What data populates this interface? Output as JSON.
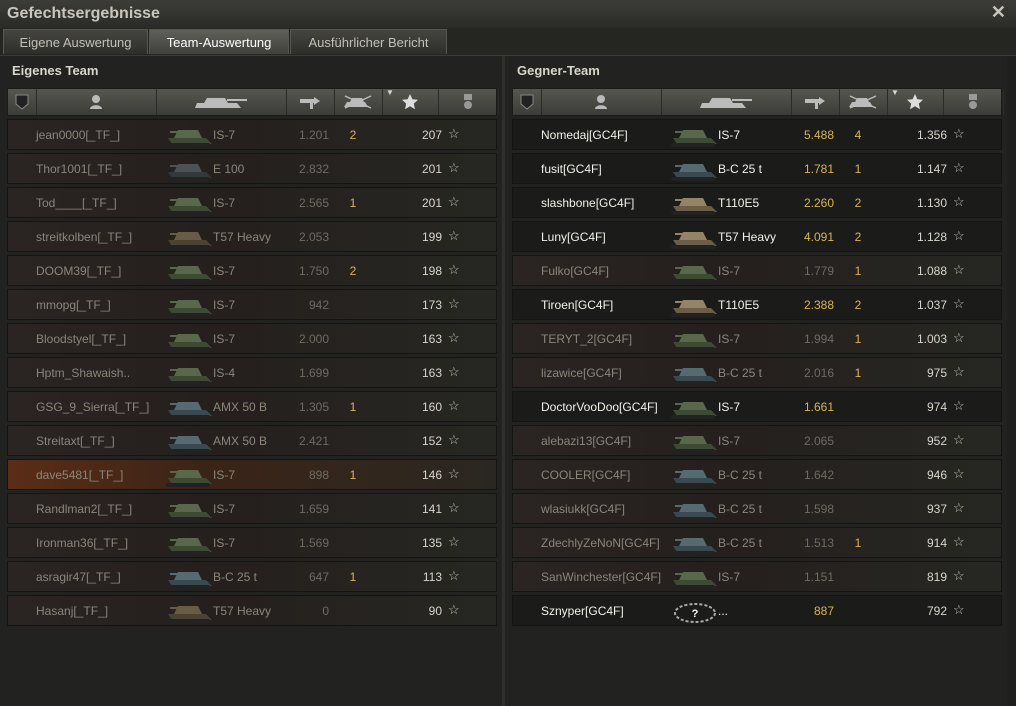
{
  "window": {
    "title": "Gefechtsergebnisse",
    "close_icon": "close-icon"
  },
  "tabs": [
    {
      "label": "Eigene Auswertung",
      "active": false
    },
    {
      "label": "Team-Auswertung",
      "active": true
    },
    {
      "label": "Ausführlicher Bericht",
      "active": false
    }
  ],
  "own_team": {
    "title": "Eigenes Team",
    "columns": [
      "vehicle-type-icon",
      "player-icon",
      "tank-icon",
      "damage-icon",
      "kills-icon",
      "xp-star-icon",
      "medal-icon"
    ],
    "rows": [
      {
        "name": "jean0000[_TF_]",
        "tank": "IS-7",
        "damage": "1.201",
        "kills": "2",
        "xp": "207",
        "highlight": false,
        "bright": false,
        "camo": "green"
      },
      {
        "name": "Thor1001[_TF_]",
        "tank": "E 100",
        "damage": "2.832",
        "kills": "",
        "xp": "201",
        "highlight": false,
        "bright": false,
        "camo": "dark"
      },
      {
        "name": "Tod____[_TF_]",
        "tank": "IS-7",
        "damage": "2.565",
        "kills": "1",
        "xp": "201",
        "highlight": false,
        "bright": false,
        "camo": "green"
      },
      {
        "name": "streitkolben[_TF_]",
        "tank": "T57 Heavy",
        "damage": "2.053",
        "kills": "",
        "xp": "199",
        "highlight": false,
        "bright": false,
        "camo": "brown"
      },
      {
        "name": "DOOM39[_TF_]",
        "tank": "IS-7",
        "damage": "1.750",
        "kills": "2",
        "xp": "198",
        "highlight": false,
        "bright": false,
        "camo": "green"
      },
      {
        "name": "mmopg[_TF_]",
        "tank": "IS-7",
        "damage": "942",
        "kills": "",
        "xp": "173",
        "highlight": false,
        "bright": false,
        "camo": "green"
      },
      {
        "name": "Bloodstyel[_TF_]",
        "tank": "IS-7",
        "damage": "2.000",
        "kills": "",
        "xp": "163",
        "highlight": false,
        "bright": false,
        "camo": "green"
      },
      {
        "name": "Hptm_Shawaish..",
        "tank": "IS-4",
        "damage": "1.699",
        "kills": "",
        "xp": "163",
        "highlight": false,
        "bright": false,
        "camo": "green"
      },
      {
        "name": "GSG_9_Sierra[_TF_]",
        "tank": "AMX 50 B",
        "damage": "1.305",
        "kills": "1",
        "xp": "160",
        "highlight": false,
        "bright": false,
        "camo": "blue"
      },
      {
        "name": "Streitaxt[_TF_]",
        "tank": "AMX 50 B",
        "damage": "2.421",
        "kills": "",
        "xp": "152",
        "highlight": false,
        "bright": false,
        "camo": "blue"
      },
      {
        "name": "dave5481[_TF_]",
        "tank": "IS-7",
        "damage": "898",
        "kills": "1",
        "xp": "146",
        "highlight": true,
        "bright": false,
        "camo": "green"
      },
      {
        "name": "Randlman2[_TF_]",
        "tank": "IS-7",
        "damage": "1.659",
        "kills": "",
        "xp": "141",
        "highlight": false,
        "bright": false,
        "camo": "green"
      },
      {
        "name": "Ironman36[_TF_]",
        "tank": "IS-7",
        "damage": "1.569",
        "kills": "",
        "xp": "135",
        "highlight": false,
        "bright": false,
        "camo": "green"
      },
      {
        "name": "asragir47[_TF_]",
        "tank": "B-C 25 t",
        "damage": "647",
        "kills": "1",
        "xp": "113",
        "highlight": false,
        "bright": false,
        "camo": "blue"
      },
      {
        "name": "Hasanj[_TF_]",
        "tank": "T57 Heavy",
        "damage": "0",
        "kills": "",
        "xp": "90",
        "highlight": false,
        "bright": false,
        "camo": "brown"
      }
    ]
  },
  "enemy_team": {
    "title": "Gegner-Team",
    "columns": [
      "vehicle-type-icon",
      "player-icon",
      "tank-icon",
      "damage-icon",
      "kills-icon",
      "xp-star-icon",
      "medal-icon"
    ],
    "rows": [
      {
        "name": "Nomedaj[GC4F]",
        "tank": "IS-7",
        "damage": "5.488",
        "kills": "4",
        "xp": "1.356",
        "highlight": false,
        "bright": true,
        "camo": "green"
      },
      {
        "name": "fusit[GC4F]",
        "tank": "B-C 25 t",
        "damage": "1.781",
        "kills": "1",
        "xp": "1.147",
        "highlight": false,
        "bright": true,
        "camo": "blue"
      },
      {
        "name": "slashbone[GC4F]",
        "tank": "T110E5",
        "damage": "2.260",
        "kills": "2",
        "xp": "1.130",
        "highlight": false,
        "bright": true,
        "camo": "tan"
      },
      {
        "name": "Luny[GC4F]",
        "tank": "T57 Heavy",
        "damage": "4.091",
        "kills": "2",
        "xp": "1.128",
        "highlight": false,
        "bright": true,
        "camo": "tan"
      },
      {
        "name": "Fulko[GC4F]",
        "tank": "IS-7",
        "damage": "1.779",
        "kills": "1",
        "xp": "1.088",
        "highlight": false,
        "bright": false,
        "camo": "green"
      },
      {
        "name": "Tiroen[GC4F]",
        "tank": "T110E5",
        "damage": "2.388",
        "kills": "2",
        "xp": "1.037",
        "highlight": false,
        "bright": true,
        "camo": "tan"
      },
      {
        "name": "TERYT_2[GC4F]",
        "tank": "IS-7",
        "damage": "1.994",
        "kills": "1",
        "xp": "1.003",
        "highlight": false,
        "bright": false,
        "camo": "green"
      },
      {
        "name": "lizawice[GC4F]",
        "tank": "B-C 25 t",
        "damage": "2.016",
        "kills": "1",
        "xp": "975",
        "highlight": false,
        "bright": false,
        "camo": "blue"
      },
      {
        "name": "DoctorVooDoo[GC4F]",
        "tank": "IS-7",
        "damage": "1.661",
        "kills": "",
        "xp": "974",
        "highlight": false,
        "bright": true,
        "camo": "green"
      },
      {
        "name": "alebazi13[GC4F]",
        "tank": "IS-7",
        "damage": "2.065",
        "kills": "",
        "xp": "952",
        "highlight": false,
        "bright": false,
        "camo": "green"
      },
      {
        "name": "COOLER[GC4F]",
        "tank": "B-C 25 t",
        "damage": "1.642",
        "kills": "",
        "xp": "946",
        "highlight": false,
        "bright": false,
        "camo": "blue"
      },
      {
        "name": "wlasiukk[GC4F]",
        "tank": "B-C 25 t",
        "damage": "1.598",
        "kills": "",
        "xp": "937",
        "highlight": false,
        "bright": false,
        "camo": "blue"
      },
      {
        "name": "ZdechlyZeNoN[GC4F]",
        "tank": "B-C 25 t",
        "damage": "1.513",
        "kills": "1",
        "xp": "914",
        "highlight": false,
        "bright": false,
        "camo": "blue"
      },
      {
        "name": "SanWinchester[GC4F]",
        "tank": "IS-7",
        "damage": "1.151",
        "kills": "",
        "xp": "819",
        "highlight": false,
        "bright": false,
        "camo": "green"
      },
      {
        "name": "Sznyper[GC4F]",
        "tank": "...",
        "damage": "887",
        "kills": "",
        "xp": "792",
        "highlight": false,
        "bright": true,
        "camo": "unknown"
      }
    ]
  },
  "colors": {
    "accent_gold": "#d8b45a",
    "highlight_row": "#5a2d17",
    "text_bright": "#f2f1ea",
    "text_dim": "#8a867c"
  }
}
